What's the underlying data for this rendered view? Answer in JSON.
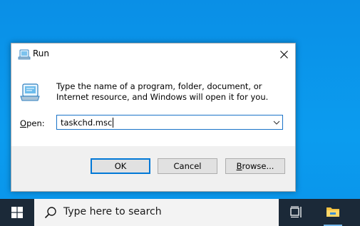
{
  "dialog": {
    "title": "Run",
    "description": "Type the name of a program, folder, document, or Internet resource, and Windows will open it for you.",
    "open_label_accel": "O",
    "open_label_rest": "pen:",
    "input_value": "taskchd.msc",
    "buttons": {
      "ok": "OK",
      "cancel": "Cancel",
      "browse_accel": "B",
      "browse_rest": "rowse..."
    }
  },
  "taskbar": {
    "search_placeholder": "Type here to search",
    "icons": [
      "windows-logo-icon",
      "search-icon",
      "task-view-icon",
      "file-explorer-icon"
    ]
  },
  "colors": {
    "desktop": "#0a94ea",
    "taskbar": "#1b2938",
    "accent": "#0078d7"
  }
}
